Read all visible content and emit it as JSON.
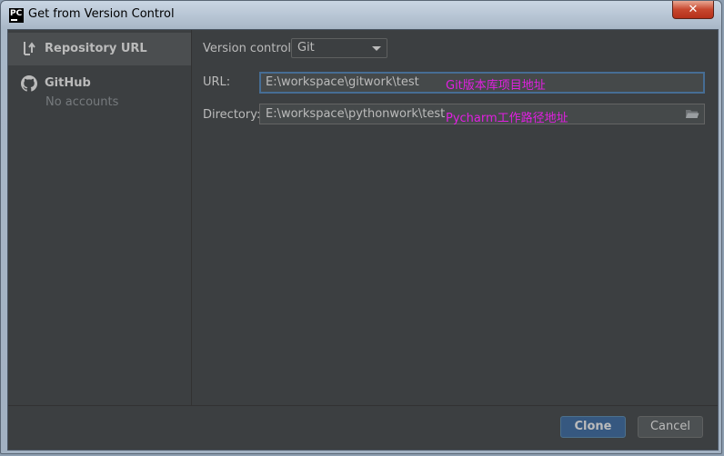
{
  "window": {
    "app_icon_text": "PC",
    "title": "Get from Version Control",
    "close_glyph": "✕"
  },
  "sidebar": {
    "items": [
      {
        "label": "Repository URL",
        "icon": "repository-url-icon",
        "selected": true
      },
      {
        "label": "GitHub",
        "sublabel": "No accounts",
        "icon": "github-icon",
        "selected": false
      }
    ]
  },
  "form": {
    "version_control_label": "Version control:",
    "version_control_value": "Git",
    "url_label": "URL:",
    "url_value": "E:\\workspace\\gitwork\\test",
    "url_annotation": "Git版本库项目地址",
    "directory_label": "Directory:",
    "directory_value": "E:\\workspace\\pythonwork\\test",
    "directory_annotation": "Pycharm工作路径地址"
  },
  "buttons": {
    "clone": "Clone",
    "cancel": "Cancel"
  },
  "colors": {
    "background": "#3c3f41",
    "selected_item": "#4b4e50",
    "primary_button": "#365880",
    "annotation": "#e020e0",
    "focus_border": "#466d94"
  }
}
